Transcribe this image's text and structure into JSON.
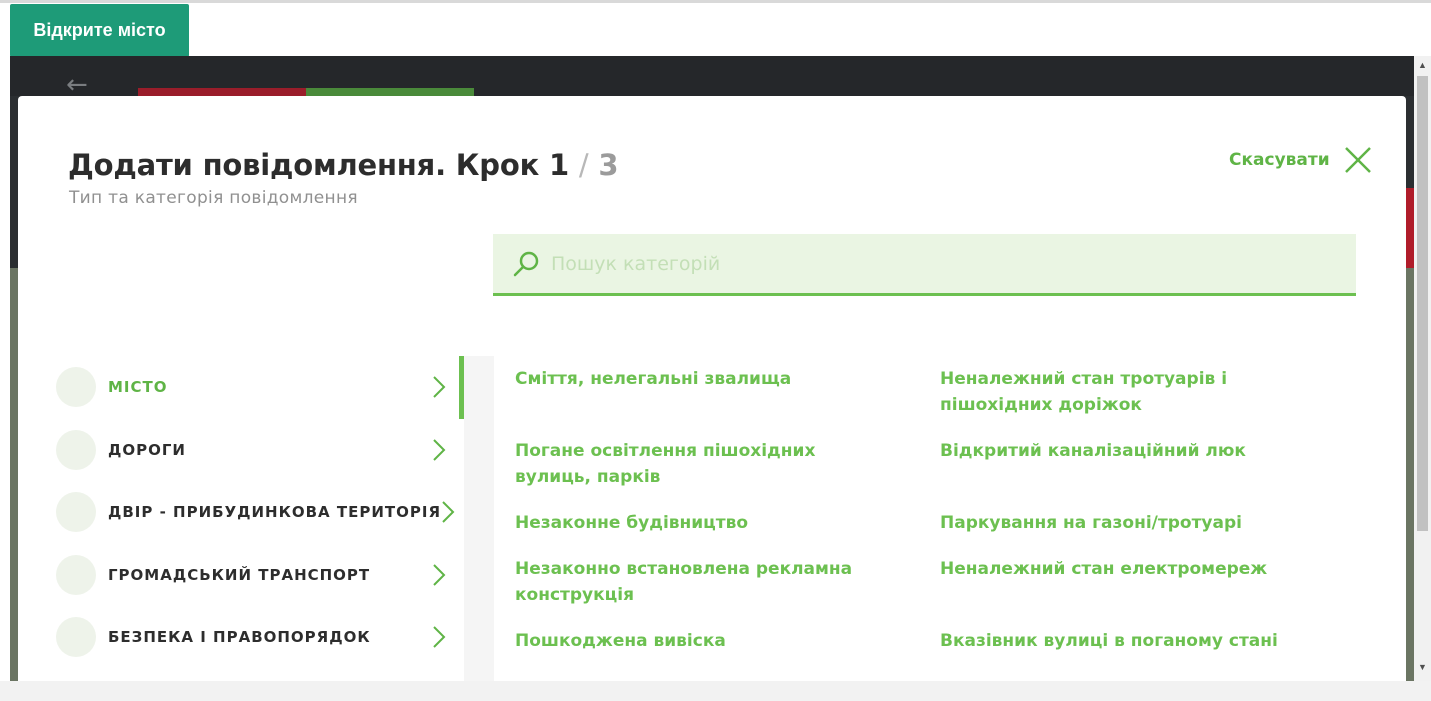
{
  "open_city_button": "Відкрите місто",
  "modal": {
    "title": "Додати повідомлення. Крок 1",
    "step_separator": "/",
    "step_total": "3",
    "subtitle": "Тип та категорія повідомлення",
    "cancel_label": "Скасувати",
    "search_placeholder": "Пошук категорій"
  },
  "sidebar": {
    "items": [
      {
        "label": "МІСТО",
        "active": true
      },
      {
        "label": "ДОРОГИ",
        "active": false
      },
      {
        "label": "ДВІР - ПРИБУДИНКОВА ТЕРИТОРІЯ",
        "active": false
      },
      {
        "label": "ГРОМАДСЬКИЙ ТРАНСПОРТ",
        "active": false
      },
      {
        "label": "БЕЗПЕКА І ПРАВОПОРЯДОК",
        "active": false
      }
    ]
  },
  "categories": [
    "Сміття, нелегальні звалища",
    "Неналежний стан тротуарів і пішохідних доріжок",
    "Погане освітлення пішохідних вулиць, парків",
    "Відкритий каналізаційний люк",
    "Незаконне будівництво",
    "Паркування на газоні/тротуарі",
    "Незаконно встановлена рекламна конструкція",
    "Неналежний стан електромереж",
    "Пошкоджена вивіска",
    "Вказівник вулиці в поганому стані"
  ],
  "colors": {
    "accent": "#6cc050",
    "open_city_button": "#1e9b78",
    "search_bg": "#eaf5e3"
  }
}
